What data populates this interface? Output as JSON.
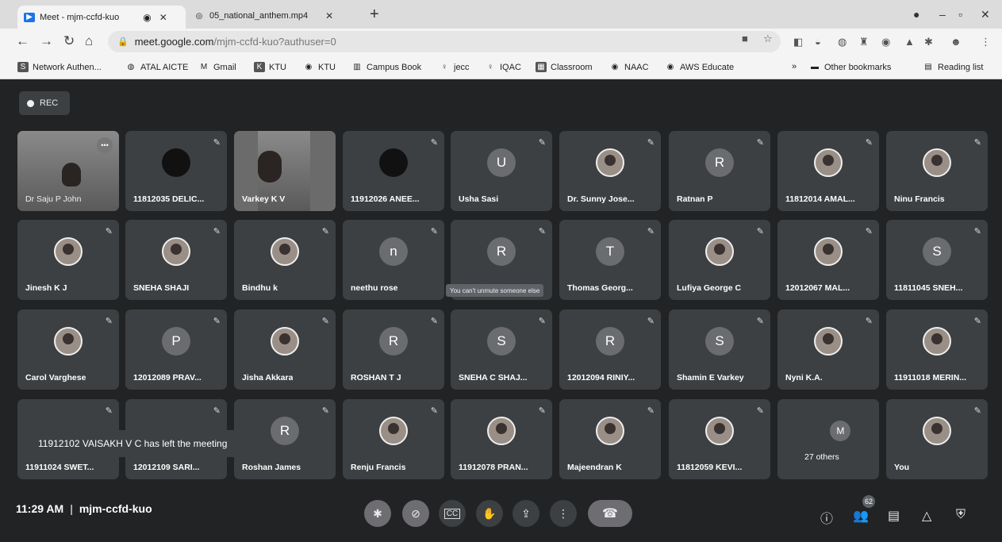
{
  "browser": {
    "tabs": [
      {
        "title": "Meet - mjm-ccfd-kuo",
        "favicon": "meet-icon",
        "active": true
      },
      {
        "title": "05_national_anthem.mp4",
        "favicon": "drive-icon",
        "active": false
      }
    ],
    "new_tab": "+",
    "url_host": "meet.google.com",
    "url_path": "/mjm-ccfd-kuo?authuser=0",
    "bookmarks": [
      "Network Authen...",
      "ATAL AICTE",
      "Gmail",
      "KTU",
      "KTU",
      "Campus Book",
      "jecc",
      "IQAC",
      "Classroom",
      "NAAC",
      "AWS Educate"
    ],
    "bookmark_overflow": "»",
    "other_bookmarks": "Other bookmarks",
    "reading_list": "Reading list"
  },
  "meet": {
    "rec_label": "REC",
    "time": "11:29 AM",
    "separator": "|",
    "meeting_code": "mjm-ccfd-kuo",
    "toast": "11912102 VAISAKH V C has left the meeting",
    "tooltip": "You can't unmute someone else",
    "people_badge": "62",
    "rows": [
      [
        {
          "name": "Dr Saju P John",
          "kind": "video"
        },
        {
          "name": "11812035 DELIC...",
          "kind": "dark"
        },
        {
          "name": "Varkey K V",
          "kind": "video"
        },
        {
          "name": "11912026 ANEE...",
          "kind": "dark"
        },
        {
          "name": "Usha Sasi",
          "kind": "letter",
          "letter": "U"
        },
        {
          "name": "Dr. Sunny Jose...",
          "kind": "photo"
        },
        {
          "name": "Ratnan P",
          "kind": "letter",
          "letter": "R"
        },
        {
          "name": "11812014 AMAL...",
          "kind": "photo"
        },
        {
          "name": "Ninu Francis",
          "kind": "photo"
        }
      ],
      [
        {
          "name": "Jinesh K J",
          "kind": "photo"
        },
        {
          "name": "SNEHA SHAJI",
          "kind": "photo"
        },
        {
          "name": "Bindhu k",
          "kind": "photo"
        },
        {
          "name": "neethu rose",
          "kind": "letter",
          "letter": "n"
        },
        {
          "name": "",
          "kind": "letter",
          "letter": "R"
        },
        {
          "name": "Thomas Georg...",
          "kind": "letter",
          "letter": "T"
        },
        {
          "name": "Lufiya George C",
          "kind": "photo"
        },
        {
          "name": "12012067 MAL...",
          "kind": "photo"
        },
        {
          "name": "11811045 SNEH...",
          "kind": "letter",
          "letter": "S"
        }
      ],
      [
        {
          "name": "Carol Varghese",
          "kind": "photo"
        },
        {
          "name": "12012089 PRAV...",
          "kind": "letter",
          "letter": "P"
        },
        {
          "name": "Jisha Akkara",
          "kind": "photo"
        },
        {
          "name": "ROSHAN T J",
          "kind": "letter",
          "letter": "R"
        },
        {
          "name": "SNEHA C SHAJ...",
          "kind": "letter",
          "letter": "S"
        },
        {
          "name": "12012094 RINIY...",
          "kind": "letter",
          "letter": "R"
        },
        {
          "name": "Shamin E Varkey",
          "kind": "letter",
          "letter": "S"
        },
        {
          "name": "Nyni K.A.",
          "kind": "photo"
        },
        {
          "name": "11911018 MERIN...",
          "kind": "photo"
        }
      ],
      [
        {
          "name": "11911024 SWET...",
          "kind": "none"
        },
        {
          "name": "12012109 SARI...",
          "kind": "none"
        },
        {
          "name": "Roshan James",
          "kind": "letter",
          "letter": "R"
        },
        {
          "name": "Renju Francis",
          "kind": "photo"
        },
        {
          "name": "11912078 PRAN...",
          "kind": "photo"
        },
        {
          "name": "Majeendran K",
          "kind": "photo"
        },
        {
          "name": "11812059 KEVI...",
          "kind": "photo"
        },
        {
          "name": "27 others",
          "kind": "others",
          "letter": "M"
        },
        {
          "name": "You",
          "kind": "photo"
        }
      ]
    ]
  }
}
